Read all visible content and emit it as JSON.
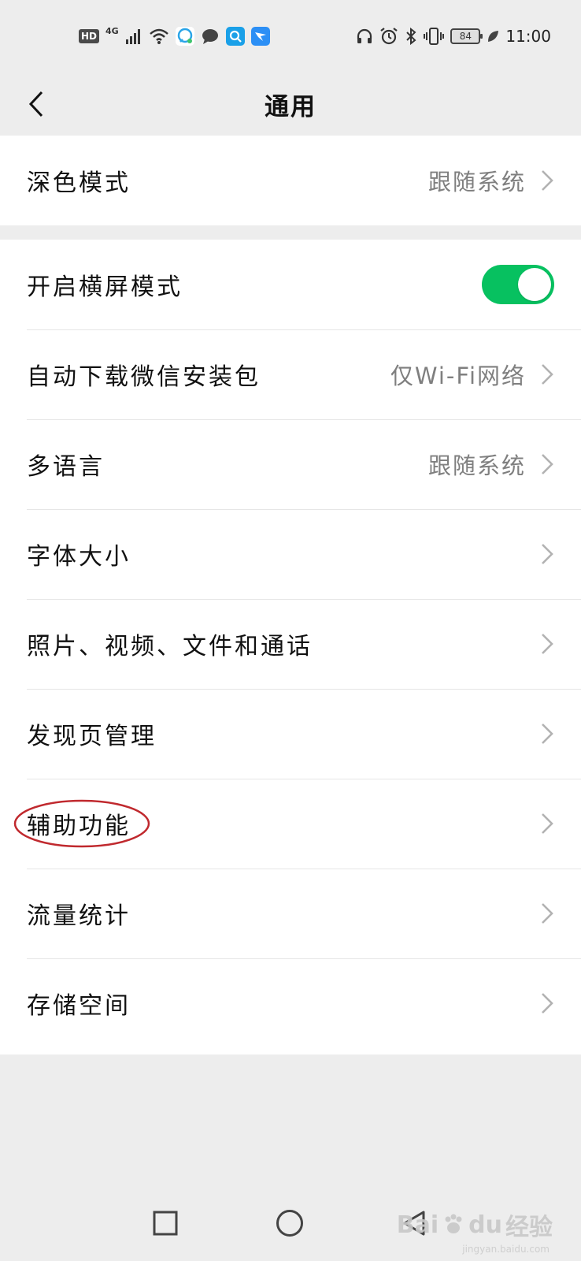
{
  "status_bar": {
    "hd": "HD",
    "network": "4G",
    "battery": "84",
    "time": "11:00"
  },
  "header": {
    "title": "通用"
  },
  "settings": {
    "dark_mode": {
      "label": "深色模式",
      "value": "跟随系统"
    },
    "landscape": {
      "label": "开启横屏模式",
      "enabled": true
    },
    "auto_download": {
      "label": "自动下载微信安装包",
      "value": "仅Wi-Fi网络"
    },
    "language": {
      "label": "多语言",
      "value": "跟随系统"
    },
    "font_size": {
      "label": "字体大小"
    },
    "media": {
      "label": "照片、视频、文件和通话"
    },
    "discover": {
      "label": "发现页管理"
    },
    "accessibility": {
      "label": "辅助功能"
    },
    "data_usage": {
      "label": "流量统计"
    },
    "storage": {
      "label": "存储空间"
    }
  },
  "colors": {
    "toggle_on": "#07c160",
    "highlight": "#c0292e",
    "background": "#ededed"
  },
  "watermark": {
    "brand": "Bai",
    "brand2": "du",
    "suffix": "经验",
    "sub": "jingyan.baidu.com"
  }
}
